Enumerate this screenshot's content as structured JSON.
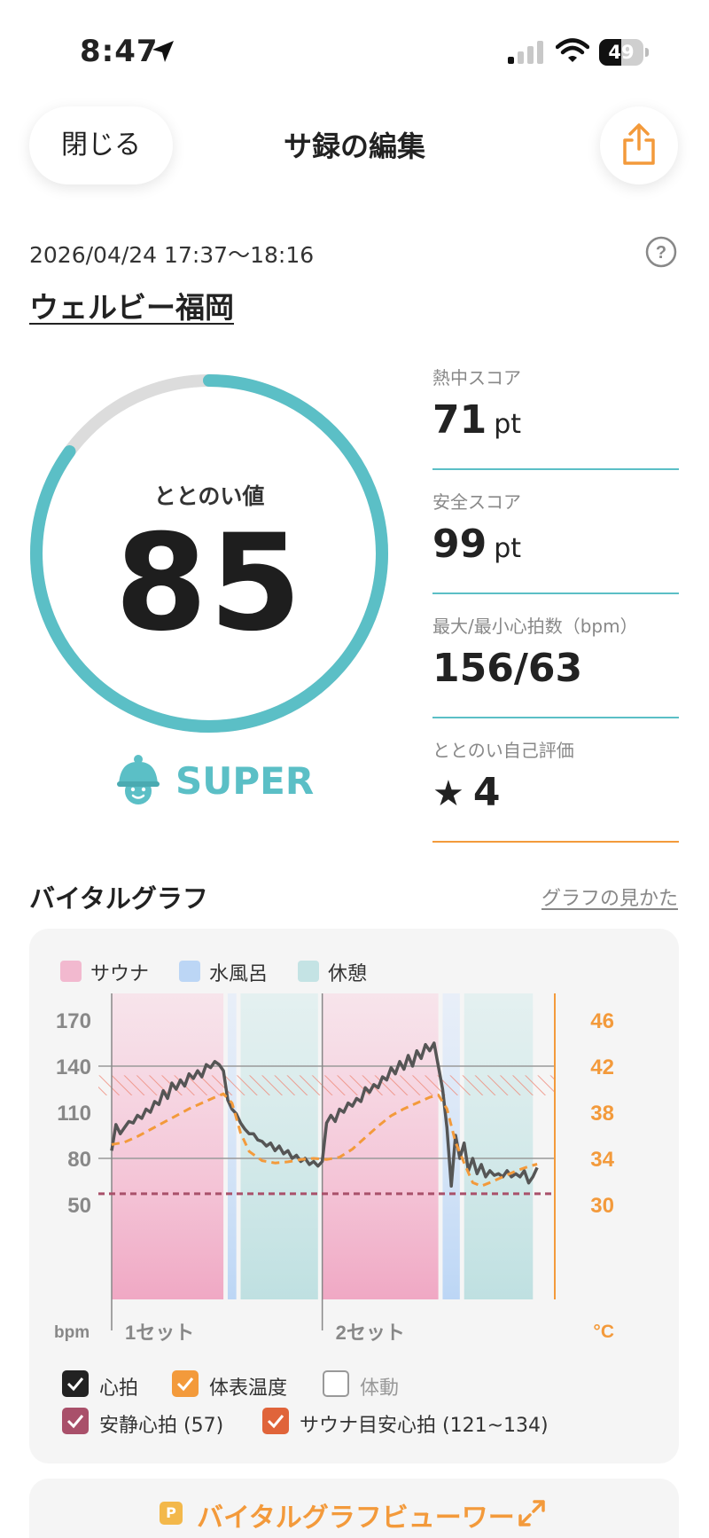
{
  "status_bar": {
    "time": "8:47",
    "battery": "49",
    "battery_level": 0.49
  },
  "header": {
    "close_label": "閉じる",
    "title": "サ録の編集"
  },
  "session": {
    "datetime": "2026/04/24 17:37～18:16",
    "facility": "ウェルビー福岡"
  },
  "totonoi": {
    "label": "ととのい値",
    "value": "85",
    "score_fraction": 0.85,
    "grade": "SUPER"
  },
  "stats": [
    {
      "label": "熱中スコア",
      "value": "71",
      "unit": "pt"
    },
    {
      "label": "安全スコア",
      "value": "99",
      "unit": "pt"
    },
    {
      "label": "最大/最小心拍数（bpm）",
      "value": "156/63",
      "unit": ""
    },
    {
      "label": "ととのい自己評価",
      "value": "4",
      "unit": ""
    }
  ],
  "vital": {
    "title": "バイタルグラフ",
    "link": "グラフの見かた",
    "legend": [
      {
        "label": "サウナ",
        "color": "#f2b9cf"
      },
      {
        "label": "水風呂",
        "color": "#bcd6f5"
      },
      {
        "label": "休憩",
        "color": "#c4e3e4"
      }
    ],
    "checkboxes": [
      {
        "label": "心拍",
        "checked": true,
        "color": "#222222"
      },
      {
        "label": "体表温度",
        "checked": true,
        "color": "#f39a3b"
      },
      {
        "label": "体動",
        "checked": false,
        "color": "#999999"
      },
      {
        "label": "安静心拍 (57)",
        "checked": true,
        "color": "#a9506a"
      },
      {
        "label": "サウナ目安心拍 (121~134)",
        "checked": true,
        "color": "#e0643a"
      }
    ]
  },
  "chart_data": {
    "type": "line",
    "x_categories": [
      "1セット",
      "2セット"
    ],
    "y_left": {
      "label": "bpm",
      "range": [
        50,
        170
      ],
      "ticks": [
        50,
        80,
        110,
        140,
        170
      ]
    },
    "y_right": {
      "label": "°C",
      "range": [
        30,
        46
      ],
      "ticks": [
        30,
        34,
        38,
        42,
        46
      ]
    },
    "x_range": [
      0,
      100
    ],
    "resting_heart_rate": 57,
    "sauna_target_range": [
      121,
      134
    ],
    "phases": [
      {
        "type": "sauna",
        "start": 0,
        "end": 26
      },
      {
        "type": "cold",
        "start": 27,
        "end": 29
      },
      {
        "type": "rest",
        "start": 30,
        "end": 48
      },
      {
        "type": "sauna",
        "start": 49,
        "end": 76
      },
      {
        "type": "cold",
        "start": 77,
        "end": 81
      },
      {
        "type": "rest",
        "start": 82,
        "end": 98
      }
    ],
    "sets": [
      {
        "name": "1セット",
        "start": 0
      },
      {
        "name": "2セット",
        "start": 49
      }
    ],
    "series": [
      {
        "name": "心拍",
        "axis": "left",
        "color": "#555555",
        "x": [
          0,
          1,
          2,
          3,
          4,
          5,
          6,
          7,
          8,
          9,
          10,
          11,
          12,
          13,
          14,
          15,
          16,
          17,
          18,
          19,
          20,
          21,
          22,
          23,
          24,
          25,
          26,
          27,
          28,
          29,
          30,
          31,
          32,
          33,
          34,
          35,
          36,
          37,
          38,
          39,
          40,
          41,
          42,
          43,
          44,
          45,
          46,
          47,
          48,
          49,
          50,
          51,
          52,
          53,
          54,
          55,
          56,
          57,
          58,
          59,
          60,
          61,
          62,
          63,
          64,
          65,
          66,
          67,
          68,
          69,
          70,
          71,
          72,
          73,
          74,
          75,
          76,
          77,
          78,
          79,
          80,
          81,
          82,
          83,
          84,
          85,
          86,
          87,
          88,
          89,
          90,
          91,
          92,
          93,
          94,
          95,
          96,
          97,
          98,
          99
        ],
        "values": [
          85,
          102,
          96,
          100,
          104,
          103,
          108,
          106,
          112,
          110,
          117,
          115,
          124,
          119,
          129,
          125,
          131,
          127,
          135,
          132,
          137,
          133,
          141,
          139,
          143,
          141,
          137,
          118,
          112,
          109,
          103,
          99,
          96,
          96,
          92,
          91,
          88,
          90,
          85,
          88,
          83,
          85,
          80,
          82,
          78,
          80,
          76,
          78,
          75,
          78,
          103,
          108,
          104,
          112,
          110,
          116,
          114,
          119,
          117,
          126,
          123,
          128,
          126,
          133,
          131,
          139,
          135,
          143,
          138,
          147,
          140,
          150,
          145,
          154,
          150,
          155,
          140,
          125,
          100,
          62,
          95,
          80,
          90,
          72,
          80,
          70,
          76,
          68,
          72,
          69,
          70,
          68,
          72,
          68,
          70,
          68,
          72,
          64,
          68,
          74
        ]
      },
      {
        "name": "体表温度",
        "axis": "right",
        "color": "#f39a3b",
        "dashed": true,
        "x": [
          0,
          3,
          6,
          9,
          12,
          15,
          18,
          21,
          24,
          26,
          28,
          30,
          32,
          35,
          38,
          41,
          44,
          47,
          50,
          53,
          56,
          59,
          62,
          65,
          68,
          71,
          74,
          76,
          78,
          80,
          82,
          84,
          86,
          88,
          91,
          94,
          97,
          99
        ],
        "values": [
          35.2,
          35.4,
          35.9,
          36.5,
          37.1,
          37.7,
          38.3,
          38.8,
          39.3,
          39.6,
          38.8,
          36.2,
          34.6,
          33.8,
          33.6,
          33.7,
          33.9,
          34.0,
          33.9,
          34.1,
          34.8,
          35.8,
          36.8,
          37.7,
          38.3,
          38.8,
          39.3,
          39.5,
          38.3,
          35.4,
          33.6,
          31.9,
          31.6,
          31.9,
          32.4,
          32.9,
          33.3,
          33.5
        ]
      }
    ]
  }
}
